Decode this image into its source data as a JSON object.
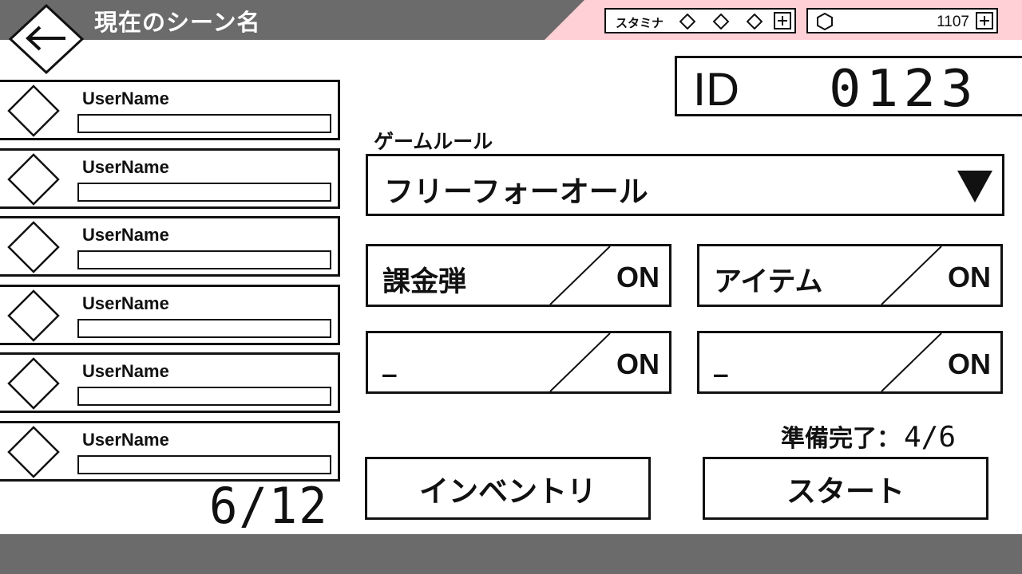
{
  "header": {
    "scene_title": "現在のシーン名",
    "back_icon": "left-arrow-icon",
    "stamina": {
      "label": "スタミナ",
      "gems": 3
    },
    "currency": {
      "icon": "hexagon-icon",
      "value": "1107"
    }
  },
  "room": {
    "id_label": "ID",
    "id_value": "0123"
  },
  "players": [
    {
      "name": "UserName"
    },
    {
      "name": "UserName"
    },
    {
      "name": "UserName"
    },
    {
      "name": "UserName"
    },
    {
      "name": "UserName"
    },
    {
      "name": "UserName"
    }
  ],
  "player_count": "6/12",
  "rule": {
    "label": "ゲームルール",
    "value": "フリーフォーオール"
  },
  "toggles": [
    {
      "name": "課金弾",
      "state": "ON"
    },
    {
      "name": "アイテム",
      "state": "ON"
    },
    {
      "name": "_",
      "state": "ON"
    },
    {
      "name": "_",
      "state": "ON"
    }
  ],
  "ready": {
    "label": "準備完了：",
    "value": "4/6"
  },
  "buttons": {
    "inventory": "インベントリ",
    "start": "スタート"
  },
  "colors": {
    "header_bg": "#6b6b6b",
    "header_accent": "#ffd0d6",
    "ink": "#111111"
  }
}
